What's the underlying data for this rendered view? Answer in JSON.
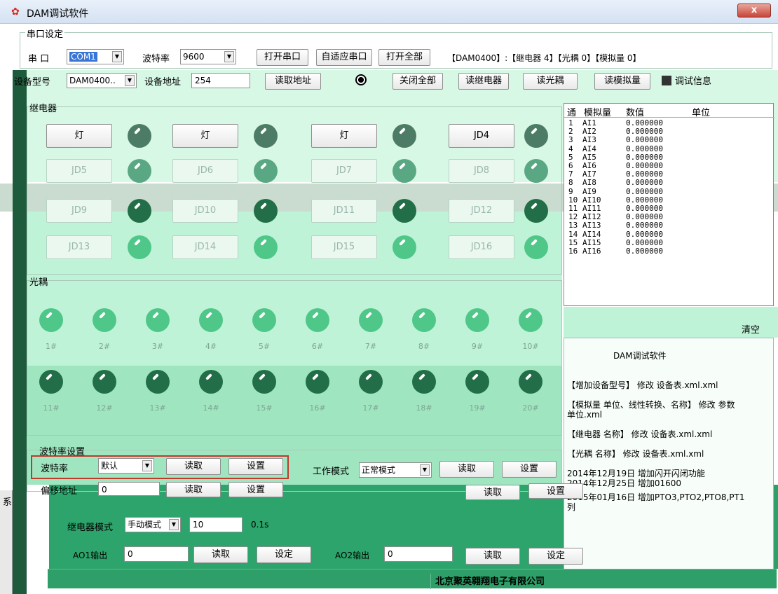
{
  "window": {
    "title": "DAM调试软件",
    "close_glyph": "x"
  },
  "serial": {
    "group_label": "串口设定",
    "port_label": "串 口",
    "port_value": "COM1",
    "baud_label": "波特率",
    "baud_value": "9600",
    "open_port": "打开串口",
    "auto_port": "自适应串口",
    "open_all": "打开全部",
    "device_summary": "【DAM0400】:【继电器 4】【光耦 0】【模拟量 0】",
    "model_label": "设备型号",
    "model_value": "DAM0400..",
    "addr_label": "设备地址",
    "addr_value": "254",
    "read_addr": "读取地址",
    "close_all": "关闭全部",
    "read_relay": "读继电器",
    "read_optical": "读光耦",
    "read_analog": "读模拟量",
    "debug_info": "调试信息"
  },
  "relay": {
    "group_label": "继电器",
    "buttons": [
      "灯",
      "灯",
      "灯",
      "JD4",
      "JD5",
      "JD6",
      "JD7",
      "JD8",
      "JD9",
      "JD10",
      "JD11",
      "JD12",
      "JD13",
      "JD14",
      "JD15",
      "JD16"
    ]
  },
  "optical": {
    "group_label": "光耦",
    "labels": [
      "1#",
      "2#",
      "3#",
      "4#",
      "5#",
      "6#",
      "7#",
      "8#",
      "9#",
      "10#",
      "11#",
      "12#",
      "13#",
      "14#",
      "15#",
      "16#",
      "17#",
      "18#",
      "19#",
      "20#"
    ]
  },
  "analog_table": {
    "headers": [
      "通",
      "模拟量",
      "数值",
      "单位"
    ],
    "rows": [
      {
        "n": "1",
        "name": "AI1",
        "val": "0.000000"
      },
      {
        "n": "2",
        "name": "AI2",
        "val": "0.000000"
      },
      {
        "n": "3",
        "name": "AI3",
        "val": "0.000000"
      },
      {
        "n": "4",
        "name": "AI4",
        "val": "0.000000"
      },
      {
        "n": "5",
        "name": "AI5",
        "val": "0.000000"
      },
      {
        "n": "6",
        "name": "AI6",
        "val": "0.000000"
      },
      {
        "n": "7",
        "name": "AI7",
        "val": "0.000000"
      },
      {
        "n": "8",
        "name": "AI8",
        "val": "0.000000"
      },
      {
        "n": "9",
        "name": "AI9",
        "val": "0.000000"
      },
      {
        "n": "10",
        "name": "AI10",
        "val": "0.000000"
      },
      {
        "n": "11",
        "name": "AI11",
        "val": "0.000000"
      },
      {
        "n": "12",
        "name": "AI12",
        "val": "0.000000"
      },
      {
        "n": "13",
        "name": "AI13",
        "val": "0.000000"
      },
      {
        "n": "14",
        "name": "AI14",
        "val": "0.000000"
      },
      {
        "n": "15",
        "name": "AI15",
        "val": "0.000000"
      },
      {
        "n": "16",
        "name": "AI16",
        "val": "0.000000"
      }
    ],
    "clear": "清空"
  },
  "info": {
    "title": "DAM调试软件",
    "lines": [
      "【增加设备型号】 修改  设备表.xml.xml",
      "【模拟量 单位、线性转换、名称】 修改 参数",
      "单位.xml",
      "【继电器 名称】 修改  设备表.xml.xml",
      "【光耦 名称】 修改  设备表.xml.xml",
      "2014年12月19日  增加闪开闪闭功能",
      "2014年12月25日  增加01600",
      "2015年01月16日  增加PTO3,PTO2,PTO8,PT1",
      "列"
    ]
  },
  "baud_settings": {
    "group_label": "波特率设置",
    "baud_label": "波特率",
    "baud_value": "默认",
    "read": "读取",
    "set": "设置",
    "mode_label": "工作模式",
    "mode_value": "正常模式",
    "offset_label": "偏移地址",
    "offset_value": "0",
    "relay_mode_label": "继电器模式",
    "relay_mode_value": "手动模式",
    "relay_time_value": "10",
    "relay_time_unit": "0.1s",
    "ao1_label": "AO1输出",
    "ao1_value": "0",
    "ao2_label": "AO2输出",
    "ao2_value": "0",
    "apply": "设定",
    "side_char": "系"
  },
  "status": {
    "company": "北京聚英翱翔电子有限公司"
  }
}
